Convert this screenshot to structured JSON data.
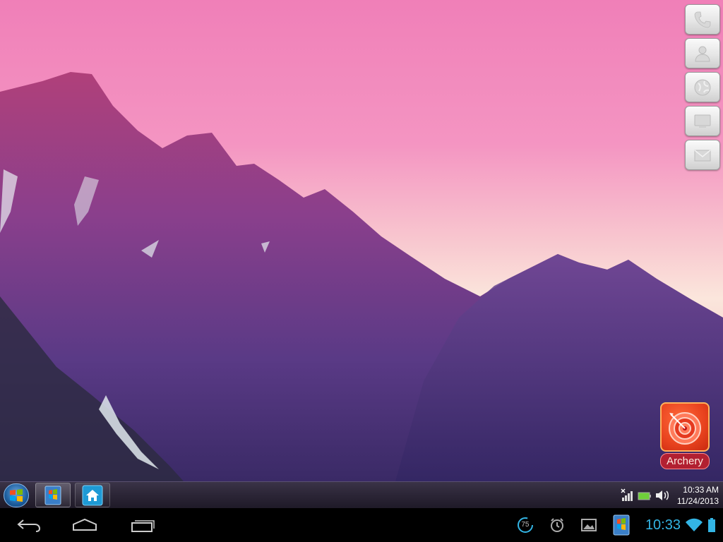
{
  "quick_launch": [
    {
      "name": "phone-icon"
    },
    {
      "name": "contacts-icon"
    },
    {
      "name": "browser-icon"
    },
    {
      "name": "desktop-icon"
    },
    {
      "name": "mail-icon"
    }
  ],
  "desktop": {
    "app_label": "Archery",
    "app_icon": "target-arrow-icon"
  },
  "taskbar": {
    "time": "10:33 AM",
    "date": "11/24/2013"
  },
  "status_bar": {
    "notification_count": "75",
    "time": "10:33"
  },
  "colors": {
    "status_accent": "#33b5e5",
    "battery": "#33b5e5",
    "archery_red": "#e8421e"
  }
}
